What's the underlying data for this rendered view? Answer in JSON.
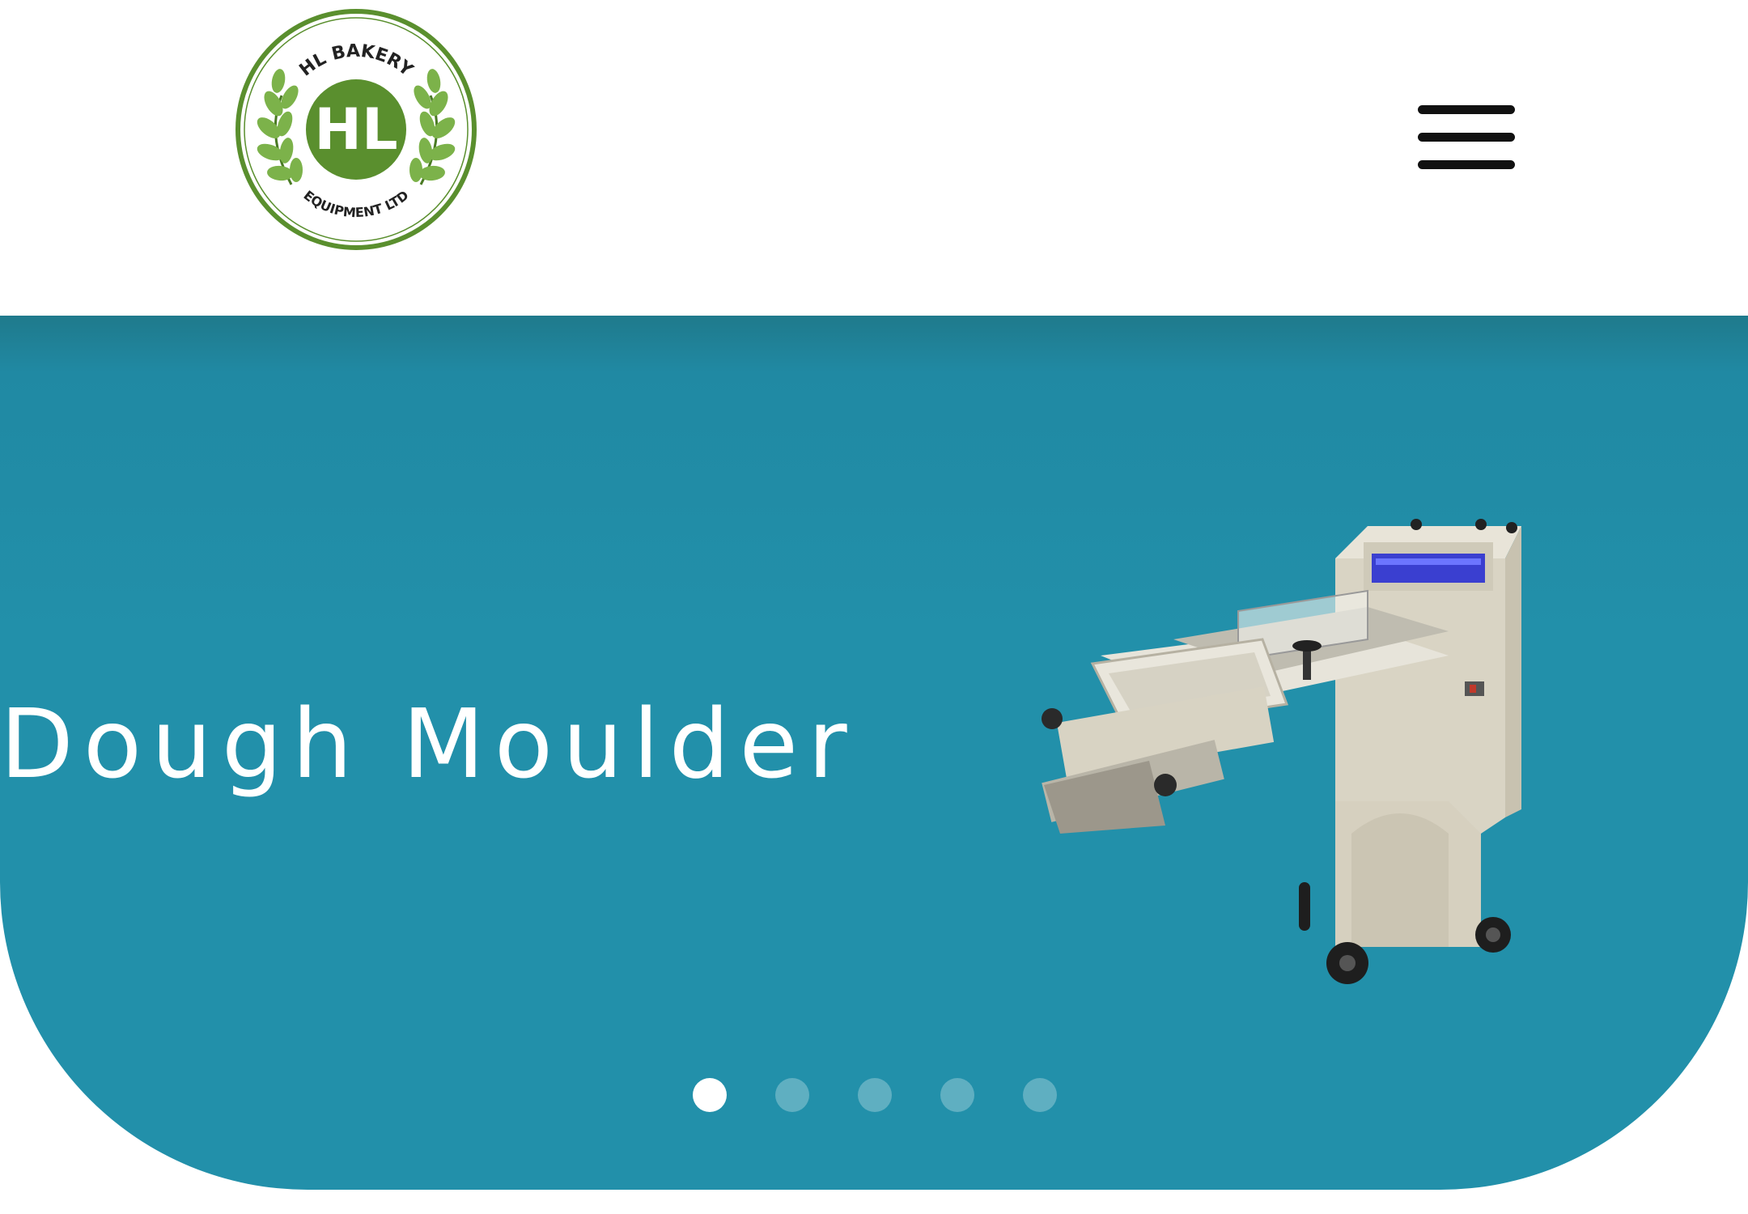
{
  "header": {
    "logo": {
      "text_top": "HL BAKERY",
      "monogram": "HL",
      "text_bottom": "EQUIPMENT LTD",
      "green": "#5a8f2e",
      "leaf_green": "#7cb24a"
    },
    "menu_icon": "hamburger-menu-icon"
  },
  "hero": {
    "background": "#2290aa",
    "title": "Dough Moulder",
    "image": "dough-moulder-machine",
    "carousel": {
      "total": 5,
      "active_index": 0
    }
  }
}
